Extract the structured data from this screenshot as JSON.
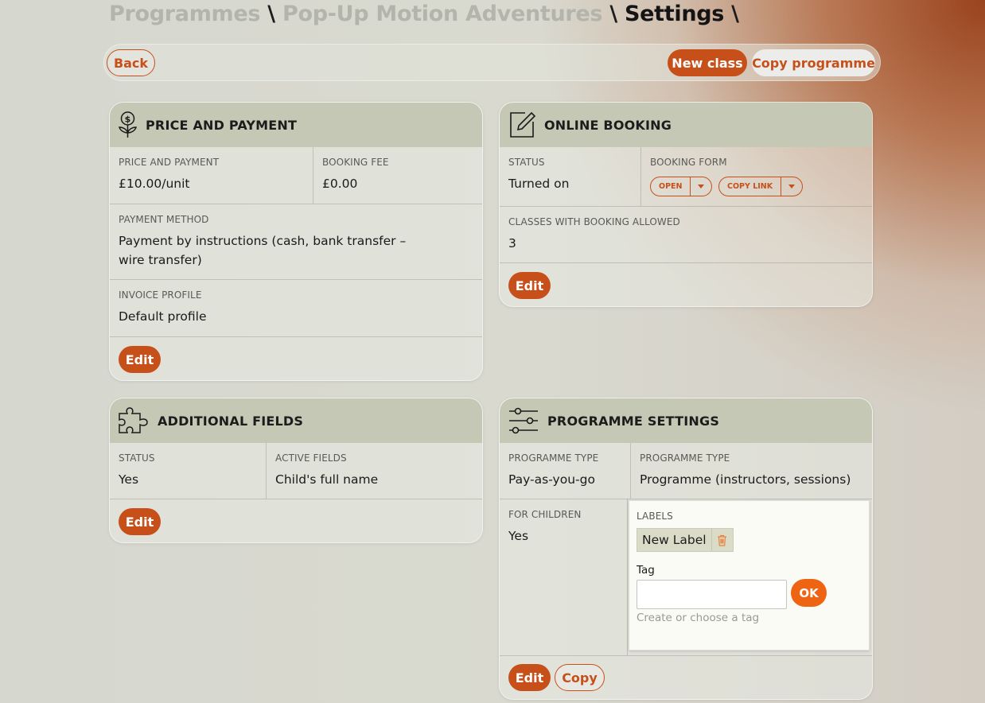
{
  "breadcrumb": {
    "item1": "Programmes",
    "item2": "Pop-Up Motion Adventures",
    "current": "Settings",
    "separator": "\\"
  },
  "toolbar": {
    "back": "Back",
    "new_class": "New class",
    "copy_programme": "Copy programme"
  },
  "price_card": {
    "title": "PRICE AND PAYMENT",
    "price_label": "PRICE AND PAYMENT",
    "price_value": "£10.00/unit",
    "fee_label": "BOOKING FEE",
    "fee_value": "£0.00",
    "method_label": "PAYMENT METHOD",
    "method_value": "Payment by instructions (cash, bank transfer – wire transfer)",
    "invoice_label": "INVOICE PROFILE",
    "invoice_value": "Default profile",
    "edit": "Edit"
  },
  "booking_card": {
    "title": "ONLINE BOOKING",
    "status_label": "STATUS",
    "status_value": "Turned on",
    "form_label": "BOOKING FORM",
    "open_btn": "OPEN",
    "copy_link_btn": "COPY LINK",
    "classes_label": "CLASSES WITH BOOKING ALLOWED",
    "classes_value": "3",
    "edit": "Edit"
  },
  "fields_card": {
    "title": "ADDITIONAL FIELDS",
    "status_label": "STATUS",
    "status_value": "Yes",
    "active_label": "ACTIVE FIELDS",
    "active_value": "Child's full name",
    "edit": "Edit"
  },
  "settings_card": {
    "title": "PROGRAMME SETTINGS",
    "type1_label": "PROGRAMME TYPE",
    "type1_value": "Pay-as-you-go",
    "type2_label": "PROGRAMME TYPE",
    "type2_value": "Programme (instructors, sessions)",
    "children_label": "FOR CHILDREN",
    "children_value": "Yes",
    "labels_label": "LABELS",
    "tag_chip": "New Label",
    "tag_field_label": "Tag",
    "tag_input_value": "",
    "tag_hint": "Create or choose a tag",
    "ok": "OK",
    "edit": "Edit",
    "copy": "Copy"
  },
  "colors": {
    "accent": "#c7501a",
    "ok_button": "#ef6413",
    "card_header": "#c4c8b4"
  },
  "icons": [
    "money-plant-icon",
    "edit-note-icon",
    "puzzle-icon",
    "sliders-icon",
    "chevron-down-icon",
    "trash-icon"
  ]
}
